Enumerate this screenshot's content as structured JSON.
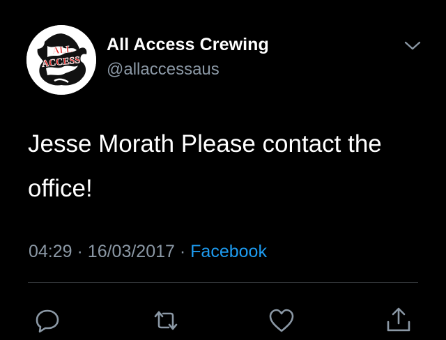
{
  "tweet": {
    "author": {
      "display_name": "All Access Crewing",
      "handle": "@allaccessaus",
      "avatar_text": [
        "ALL",
        "ACCESS"
      ]
    },
    "text": "Jesse Morath Please contact the office!",
    "timestamp_time": "04:29",
    "separator": "·",
    "timestamp_date": "16/03/2017",
    "source": "Facebook"
  },
  "actions": [
    "reply-icon",
    "retweet-icon",
    "like-icon",
    "share-icon"
  ],
  "colors": {
    "background": "#000000",
    "text": "#ffffff",
    "secondary": "#8b98a5",
    "link": "#1d9bf0",
    "divider": "#2f3336",
    "logo_red": "#e02020"
  }
}
